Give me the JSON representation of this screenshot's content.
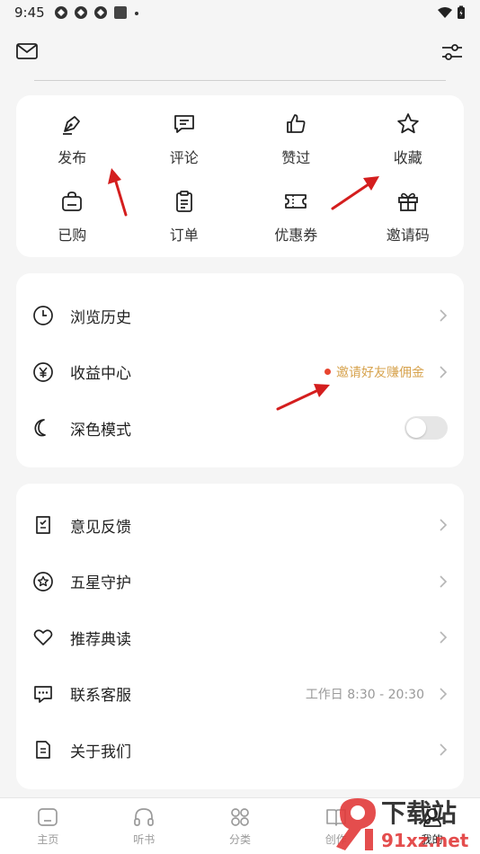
{
  "status": {
    "time": "9:45"
  },
  "quick_actions": [
    {
      "label": "发布",
      "icon": "pen-icon"
    },
    {
      "label": "评论",
      "icon": "comment-icon"
    },
    {
      "label": "赞过",
      "icon": "thumbs-up-icon"
    },
    {
      "label": "收藏",
      "icon": "star-icon"
    },
    {
      "label": "已购",
      "icon": "shopping-bag-icon"
    },
    {
      "label": "订单",
      "icon": "clipboard-icon"
    },
    {
      "label": "优惠券",
      "icon": "ticket-icon"
    },
    {
      "label": "邀请码",
      "icon": "gift-icon"
    }
  ],
  "section1": {
    "history": "浏览历史",
    "earnings": "收益中心",
    "earnings_promo": "邀请好友赚佣金",
    "dark_mode": "深色模式",
    "dark_mode_on": false
  },
  "section2": {
    "feedback": "意见反馈",
    "five_star": "五星守护",
    "recommended": "推荐典读",
    "contact": "联系客服",
    "contact_hours": "工作日 8:30 - 20:30",
    "about": "关于我们"
  },
  "nav": {
    "home": "主页",
    "listen": "听书",
    "category": "分类",
    "create": "创作",
    "mine": "我的"
  },
  "watermark": {
    "brand": "下载站",
    "domain": "91xz.net"
  },
  "colors": {
    "accent_red": "#e8452f",
    "promo_gold": "#d7a34e",
    "annotation_arrow": "#d41e1e"
  }
}
